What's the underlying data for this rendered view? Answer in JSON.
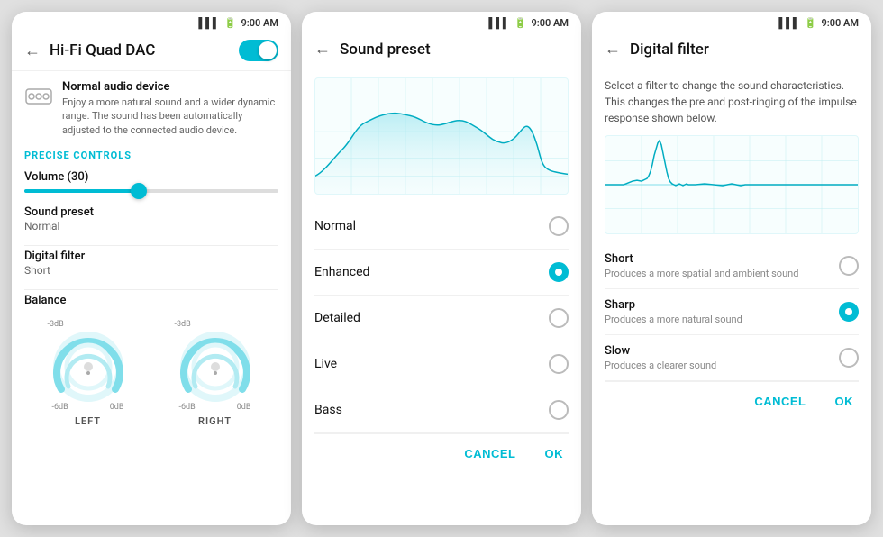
{
  "panel1": {
    "statusTime": "9:00 AM",
    "title": "Hi-Fi Quad DAC",
    "deviceTitle": "Normal audio device",
    "deviceDesc": "Enjoy a more natural sound and a wider dynamic range. The sound has been automatically adjusted to the connected audio device.",
    "sectionLabel": "pReCiSE CONTROLS",
    "volumeLabel": "Volume (30)",
    "volumePercent": 45,
    "soundPresetLabel": "Sound preset",
    "soundPresetValue": "Normal",
    "digitalFilterLabel": "Digital filter",
    "digitalFilterValue": "Short",
    "balanceLabel": "Balance",
    "leftLabel": "LEFT",
    "rightLabel": "RIGHT",
    "leftDb1": "-3dB",
    "leftDb2": "-6dB",
    "leftDb3": "0dB",
    "rightDb1": "-3dB",
    "rightDb2": "-6dB",
    "rightDb3": "0dB"
  },
  "panel2": {
    "statusTime": "9:00 AM",
    "title": "Sound preset",
    "presets": [
      {
        "name": "Normal",
        "selected": false
      },
      {
        "name": "Enhanced",
        "selected": true
      },
      {
        "name": "Detailed",
        "selected": false
      },
      {
        "name": "Live",
        "selected": false
      },
      {
        "name": "Bass",
        "selected": false
      }
    ],
    "cancelLabel": "CANCEL",
    "okLabel": "OK"
  },
  "panel3": {
    "statusTime": "9:00 AM",
    "title": "Digital filter",
    "description": "Select a filter to change the sound characteristics. This changes the pre and post-ringing of the impulse response shown below.",
    "filters": [
      {
        "name": "Short",
        "desc": "Produces a more spatial and ambient sound",
        "selected": false
      },
      {
        "name": "Sharp",
        "desc": "Produces a more natural sound",
        "selected": true
      },
      {
        "name": "Slow",
        "desc": "Produces a clearer sound",
        "selected": false
      }
    ],
    "cancelLabel": "CANCEL",
    "okLabel": "OK"
  }
}
